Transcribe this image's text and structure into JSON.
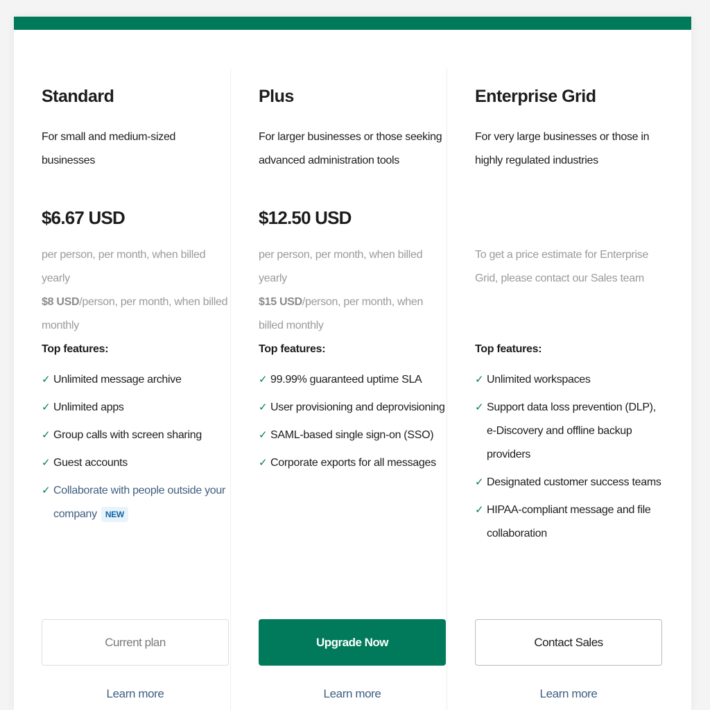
{
  "colors": {
    "brand": "#007a5a",
    "link": "#3f5e80",
    "muted": "#9a9a9a"
  },
  "plans": [
    {
      "name": "Standard",
      "description": "For small and medium-sized businesses",
      "price": "$6.67 USD",
      "price_note_yearly": "per person, per month, when billed yearly",
      "price_monthly_amount": "$8 USD",
      "price_monthly_note": "/person, per month, when billed monthly",
      "features_title": "Top features:",
      "features": [
        "Unlimited message archive",
        "Unlimited apps",
        "Group calls with screen sharing",
        "Guest accounts"
      ],
      "link_feature": "Collaborate with people outside your company",
      "link_feature_badge": "NEW",
      "button_label": "Current plan",
      "learn_more": "Learn more"
    },
    {
      "name": "Plus",
      "description": "For larger businesses or those seeking advanced administration tools",
      "price": "$12.50 USD",
      "price_note_yearly": "per person, per month, when billed yearly",
      "price_monthly_amount": "$15 USD",
      "price_monthly_note": "/person, per month, when billed monthly",
      "features_title": "Top features:",
      "features": [
        "99.99% guaranteed uptime SLA",
        "User provisioning and deprovisioning",
        "SAML-based single sign-on (SSO)",
        "Corporate exports for all messages"
      ],
      "button_label": "Upgrade Now",
      "learn_more": "Learn more"
    },
    {
      "name": "Enterprise Grid",
      "description": "For very large businesses or those in highly regulated industries",
      "price_contact_note": "To get a price estimate for Enterprise Grid, please contact our Sales team",
      "features_title": "Top features:",
      "features": [
        "Unlimited workspaces",
        "Support data loss prevention (DLP), e-Discovery and offline backup providers",
        "Designated customer success teams",
        "HIPAA-compliant message and file collaboration"
      ],
      "button_label": "Contact Sales",
      "learn_more": "Learn more"
    }
  ],
  "icons": {
    "check": "✓"
  }
}
